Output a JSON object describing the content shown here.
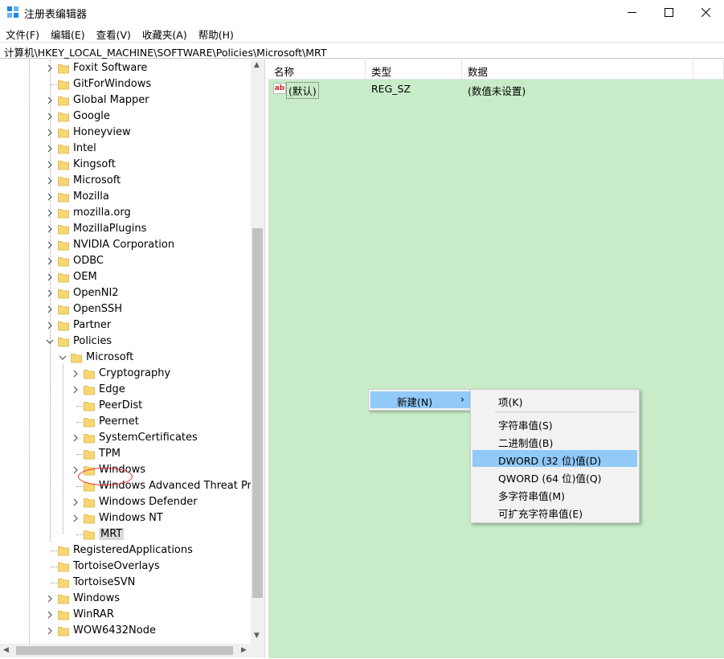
{
  "window": {
    "title": "注册表编辑器",
    "app_icon": "regedit-icon",
    "buttons": [
      "minimize-icon",
      "maximize-icon",
      "close-icon"
    ]
  },
  "menu": [
    "文件(F)",
    "编辑(E)",
    "查看(V)",
    "收藏夹(A)",
    "帮助(H)"
  ],
  "address": "计算机\\HKEY_LOCAL_MACHINE\\SOFTWARE\\Policies\\Microsoft\\MRT",
  "tree": [
    {
      "label": "Foxit Software",
      "level": 1,
      "expandable": true
    },
    {
      "label": "GitForWindows",
      "level": 1,
      "expandable": false
    },
    {
      "label": "Global Mapper",
      "level": 1,
      "expandable": true
    },
    {
      "label": "Google",
      "level": 1,
      "expandable": true
    },
    {
      "label": "Honeyview",
      "level": 1,
      "expandable": true
    },
    {
      "label": "Intel",
      "level": 1,
      "expandable": true
    },
    {
      "label": "Kingsoft",
      "level": 1,
      "expandable": true
    },
    {
      "label": "Microsoft",
      "level": 1,
      "expandable": true
    },
    {
      "label": "Mozilla",
      "level": 1,
      "expandable": true
    },
    {
      "label": "mozilla.org",
      "level": 1,
      "expandable": true
    },
    {
      "label": "MozillaPlugins",
      "level": 1,
      "expandable": true
    },
    {
      "label": "NVIDIA Corporation",
      "level": 1,
      "expandable": true
    },
    {
      "label": "ODBC",
      "level": 1,
      "expandable": true
    },
    {
      "label": "OEM",
      "level": 1,
      "expandable": true
    },
    {
      "label": "OpenNI2",
      "level": 1,
      "expandable": true
    },
    {
      "label": "OpenSSH",
      "level": 1,
      "expandable": true
    },
    {
      "label": "Partner",
      "level": 1,
      "expandable": true
    },
    {
      "label": "Policies",
      "level": 1,
      "expandable": true,
      "expanded": true
    },
    {
      "label": "Microsoft",
      "level": 2,
      "expandable": true,
      "expanded": true
    },
    {
      "label": "Cryptography",
      "level": 3,
      "expandable": true
    },
    {
      "label": "Edge",
      "level": 3,
      "expandable": true
    },
    {
      "label": "PeerDist",
      "level": 3,
      "expandable": false
    },
    {
      "label": "Peernet",
      "level": 3,
      "expandable": false
    },
    {
      "label": "SystemCertificates",
      "level": 3,
      "expandable": true
    },
    {
      "label": "TPM",
      "level": 3,
      "expandable": false
    },
    {
      "label": "Windows",
      "level": 3,
      "expandable": true
    },
    {
      "label": "Windows Advanced Threat Prote",
      "level": 3,
      "expandable": false
    },
    {
      "label": "Windows Defender",
      "level": 3,
      "expandable": true
    },
    {
      "label": "Windows NT",
      "level": 3,
      "expandable": true
    },
    {
      "label": "MRT",
      "level": 3,
      "expandable": false,
      "selected": true
    },
    {
      "label": "RegisteredApplications",
      "level": 1,
      "expandable": false
    },
    {
      "label": "TortoiseOverlays",
      "level": 1,
      "expandable": false
    },
    {
      "label": "TortoiseSVN",
      "level": 1,
      "expandable": false
    },
    {
      "label": "Windows",
      "level": 1,
      "expandable": true
    },
    {
      "label": "WinRAR",
      "level": 1,
      "expandable": true
    },
    {
      "label": "WOW6432Node",
      "level": 1,
      "expandable": true
    }
  ],
  "columns": {
    "name": "名称",
    "type": "类型",
    "data": "数据"
  },
  "values": [
    {
      "icon": "string-value-icon",
      "icon_text": "ab",
      "name": "(默认)",
      "type": "REG_SZ",
      "data": "(数值未设置)"
    }
  ],
  "context_menu": {
    "new_label": "新建(N)",
    "submenu": [
      {
        "label": "项(K)"
      },
      {
        "label": "字符串值(S)"
      },
      {
        "label": "二进制值(B)"
      },
      {
        "label": "DWORD (32 位)值(D)",
        "highlighted": true
      },
      {
        "label": "QWORD (64 位)值(Q)"
      },
      {
        "label": "多字符串值(M)"
      },
      {
        "label": "可扩充字符串值(E)"
      }
    ]
  },
  "colors": {
    "value_pane_bg": "#c8ecc8",
    "menu_highlight": "#91c9f7",
    "folder": "#f7d774",
    "selection_ring": "#e0262a"
  }
}
